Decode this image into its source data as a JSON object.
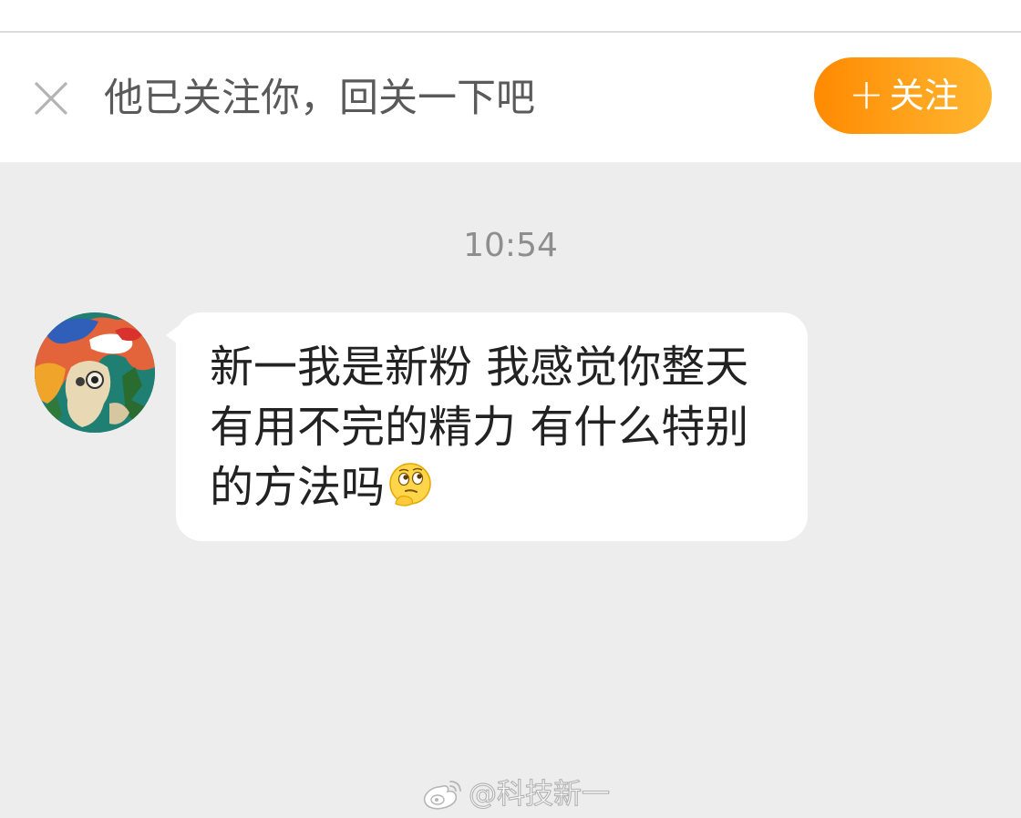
{
  "banner": {
    "message": "他已关注你，回关一下吧",
    "follow_plus": "+",
    "follow_label": "关注",
    "accent_color": "#ff9a0e"
  },
  "conversation": {
    "timestamp": "10:54",
    "messages": [
      {
        "sender": "other",
        "text": "新一我是新粉 我感觉你整天有用不完的精力 有什么特别的方法吗",
        "emoji": "thinking-face-icon"
      }
    ]
  },
  "watermark": {
    "text": "@科技新一",
    "icon": "weibo-logo-icon"
  }
}
